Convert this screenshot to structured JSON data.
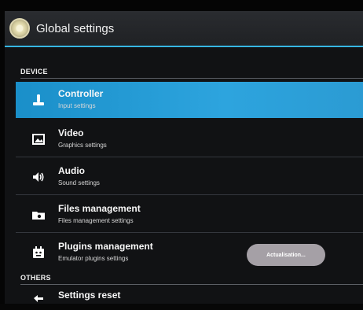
{
  "titlebar": {
    "title": "Global settings",
    "logo_icon": "emulator-logo-icon"
  },
  "sections": {
    "device": "DEVICE",
    "others": "OTHERS"
  },
  "items": [
    {
      "label": "Controller",
      "sub": "Input settings",
      "icon": "joystick-icon",
      "selected": true
    },
    {
      "label": "Video",
      "sub": "Graphics settings",
      "icon": "image-icon"
    },
    {
      "label": "Audio",
      "sub": "Sound settings",
      "icon": "speaker-icon"
    },
    {
      "label": "Files management",
      "sub": "Files management settings",
      "icon": "folder-icon"
    },
    {
      "label": "Plugins management",
      "sub": "Emulator plugins settings",
      "icon": "plugin-icon"
    },
    {
      "label": "Settings reset",
      "icon": "reset-arrow-icon"
    }
  ],
  "toast": {
    "text": "Actualisation..."
  },
  "colors": {
    "accent": "#36b6e3",
    "selected": "#2da4de",
    "background": "#111214"
  }
}
